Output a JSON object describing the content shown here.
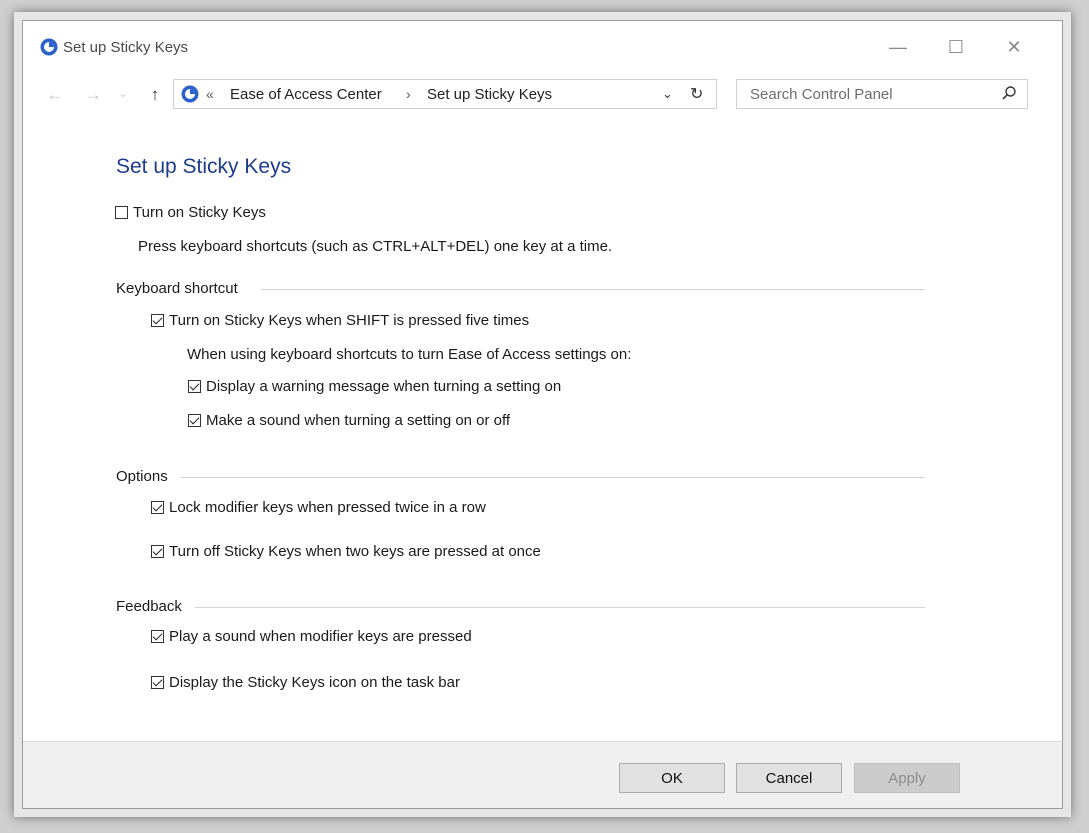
{
  "window": {
    "title": "Set up Sticky Keys",
    "controls": {
      "minimize": "—",
      "maximize": "☐",
      "close": "✕"
    }
  },
  "nav": {
    "back_icon": "←",
    "forward_icon": "→",
    "recent_icon": "⌄",
    "up_icon": "↑",
    "address": {
      "chevrons": "«",
      "crumbs": [
        "Ease of Access Center",
        "Set up Sticky Keys"
      ],
      "separator": "›",
      "dropdown_icon": "⌄",
      "refresh_icon": "↻"
    },
    "search": {
      "placeholder": "Search Control Panel",
      "value": ""
    }
  },
  "page": {
    "title": "Set up Sticky Keys",
    "turn_on": {
      "label": "Turn on Sticky Keys",
      "checked": false
    },
    "turn_on_desc": "Press keyboard shortcuts (such as CTRL+ALT+DEL) one key at a time."
  },
  "sections": {
    "keyboard_shortcut": {
      "heading": "Keyboard shortcut",
      "shift_five": {
        "label": "Turn on Sticky Keys when SHIFT is pressed five times",
        "checked": true
      },
      "sub_desc": "When using keyboard shortcuts to turn Ease of Access settings on:",
      "warning": {
        "label": "Display a warning message when turning a setting on",
        "checked": true
      },
      "sound": {
        "label": "Make a sound when turning a setting on or off",
        "checked": true
      }
    },
    "options": {
      "heading": "Options",
      "lock_modifier": {
        "label": "Lock modifier keys when pressed twice in a row",
        "checked": true
      },
      "turn_off_two": {
        "label": "Turn off Sticky Keys when two keys are pressed at once",
        "checked": true
      }
    },
    "feedback": {
      "heading": "Feedback",
      "play_sound": {
        "label": "Play a sound when modifier keys are pressed",
        "checked": true
      },
      "taskbar_icon": {
        "label": "Display the Sticky Keys icon on the task bar",
        "checked": true
      }
    }
  },
  "footer": {
    "ok_label": "OK",
    "cancel_label": "Cancel",
    "apply_label": "Apply"
  },
  "colors": {
    "title_accent": "#1e3c8c",
    "control_panel_icon": "#2a62c9"
  }
}
